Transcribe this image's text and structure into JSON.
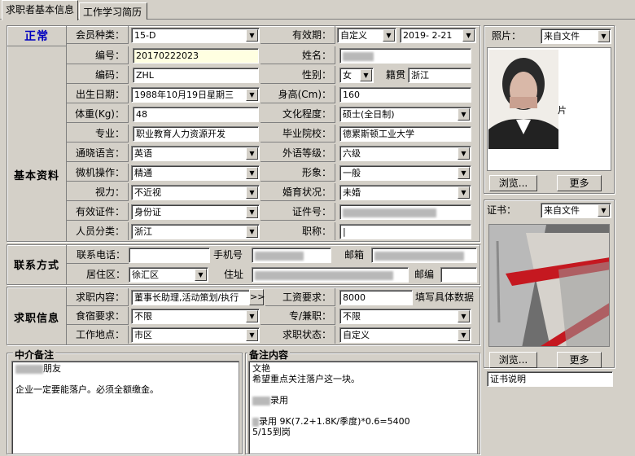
{
  "tabs": [
    "求职者基本信息",
    "工作学习简历"
  ],
  "status": "正常",
  "sections": {
    "basic": "基本资料",
    "contact": "联系方式",
    "job": "求职信息"
  },
  "member_type": {
    "label": "会员种类：",
    "value": "15-D"
  },
  "validity": {
    "label": "有效期：",
    "type": "自定义",
    "date": "2019- 2-21"
  },
  "basic": {
    "id_label": "编号：",
    "id_value": "20170222023",
    "name_label": "姓名：",
    "code_label": "编码：",
    "code_value": "ZHL",
    "gender_label": "性别：",
    "gender_value": "女",
    "origin_label": "籍贯",
    "origin_value": "浙江",
    "birth_label": "出生日期：",
    "birth_value": "1988年10月19日星期三",
    "height_label": "身高(Cm)：",
    "height_value": "160",
    "weight_label": "体重(Kg)：",
    "weight_value": "48",
    "edu_label": "文化程度：",
    "edu_value": "硕士(全日制)",
    "major_label": "专业：",
    "major_value": "职业教育人力资源开发",
    "school_label": "毕业院校：",
    "school_value": "德累斯顿工业大学",
    "lang_label": "通晓语言：",
    "lang_value": "英语",
    "lang_level_label": "外语等级：",
    "lang_level_value": "六级",
    "pc_label": "微机操作：",
    "pc_value": "精通",
    "image_label": "形象：",
    "image_value": "一般",
    "vision_label": "视力：",
    "vision_value": "不近视",
    "marital_label": "婚育状况：",
    "marital_value": "未婚",
    "idtype_label": "有效证件：",
    "idtype_value": "身份证",
    "idno_label": "证件号：",
    "category_label": "人员分类：",
    "category_value": "浙江",
    "title_label": "职称："
  },
  "contact": {
    "phone_label": "联系电话：",
    "mobile_label": "手机号",
    "email_label": "邮箱",
    "area_label": "居住区：",
    "area_value": "徐汇区",
    "addr_label": "住址",
    "zip_label": "邮编"
  },
  "job": {
    "content_label": "求职内容：",
    "content_value": "董事长助理,活动策划/执行",
    "more": ">>",
    "salary_label": "工资要求：",
    "salary_value": "8000",
    "salary_hint": "填写具体数据",
    "board_label": "食宿要求：",
    "board_value": "不限",
    "fulltime_label": "专/兼职：",
    "fulltime_value": "不限",
    "place_label": "工作地点：",
    "place_value": "市区",
    "state_label": "求职状态：",
    "state_value": "自定义"
  },
  "photo": {
    "label": "照片：",
    "source": "来自文件",
    "browse": "浏览...",
    "more": "更多",
    "suffix": "片"
  },
  "cert": {
    "label": "证书：",
    "source": "来自文件",
    "browse": "浏览...",
    "more": "更多",
    "desc": "证书说明"
  },
  "agency_notes": {
    "title": "中介备注",
    "line1": "朋友",
    "line2": "企业一定要能落户。必须全额缴金。"
  },
  "remarks": {
    "title": "备注内容",
    "line1": "文艳",
    "line2": "希望重点关注落户这一块。",
    "line3": "录用",
    "line4": "录用 9K(7.2+1.8K/季度)*0.6=5400",
    "line5": "5/15到岗"
  },
  "colors": {
    "status": "#0000c0",
    "window": "#d4d0c8",
    "highlight_field": "#ffffe1"
  }
}
